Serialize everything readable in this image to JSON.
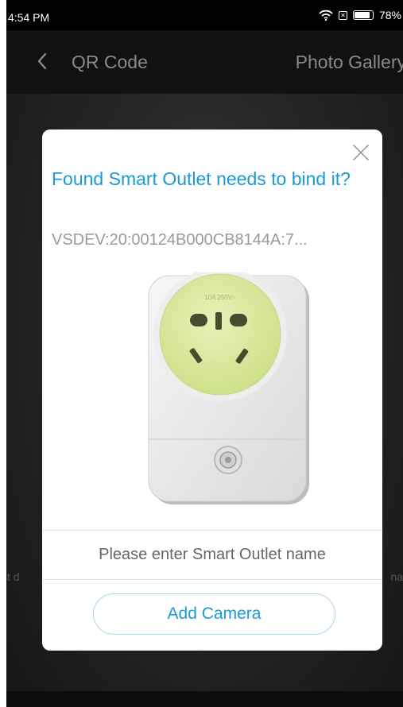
{
  "status_bar": {
    "time": "4:54 PM",
    "sim_glyph": "✕",
    "battery": "78%",
    "battery_level": 0.78,
    "icons": [
      "wifi-icon",
      "sim-icon",
      "battery-icon"
    ]
  },
  "nav": {
    "back_icon": "chevron-left-icon",
    "title": "QR Code",
    "action_label": "Photo Gallery"
  },
  "background": {
    "left_fragment": "ct d",
    "right_fragment": "nat"
  },
  "dialog": {
    "close_icon": "close-icon",
    "title": "Found Smart Outlet needs to bind it?",
    "device_id": "VSDEV:20:00124B000CB8144A:7...",
    "image": "smart-outlet-image",
    "name_placeholder": "Please enter Smart Outlet name",
    "name_value": "",
    "button_label": "Add Camera"
  },
  "colors": {
    "accent": "#1a9bd7",
    "button_border": "#a8d6ee",
    "outlet_face": "#dbe9a2"
  }
}
